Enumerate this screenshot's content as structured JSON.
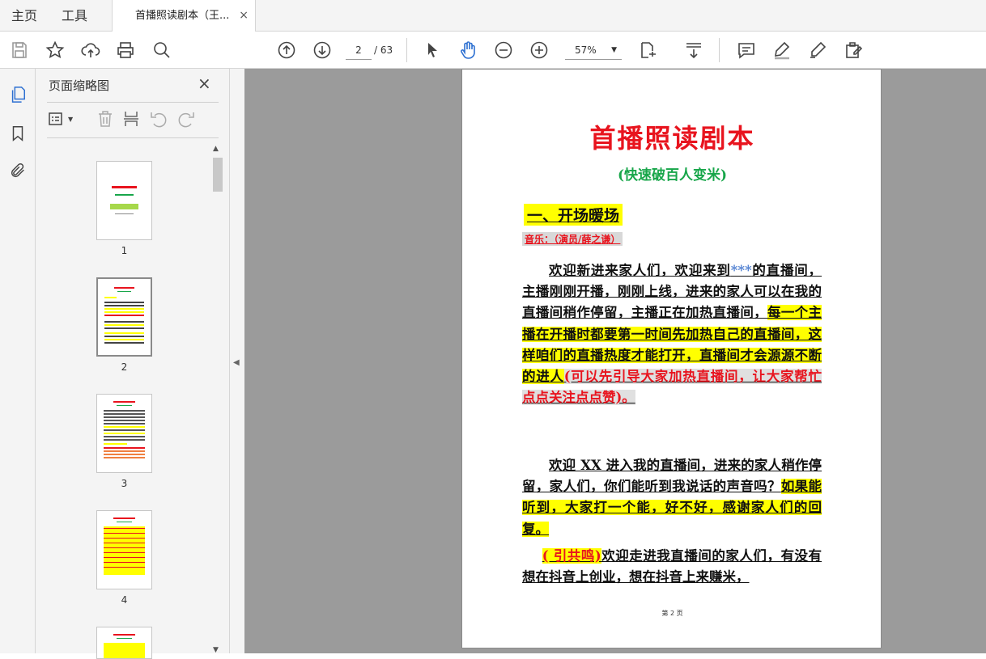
{
  "tabs": {
    "home": "主页",
    "tools": "工具",
    "doc": "首播照读剧本（王...",
    "doc_close": "×"
  },
  "toolbar": {
    "page_current": "2",
    "page_total": "/ 63",
    "zoom": "57%",
    "icons": [
      "save-icon",
      "star-icon",
      "cloud-upload-icon",
      "print-icon",
      "zoom-search-icon",
      "page-up-icon",
      "page-down-icon",
      "select-arrow-icon",
      "hand-icon",
      "zoom-out-icon",
      "zoom-in-icon",
      "fit-page-icon",
      "scroll-mode-icon",
      "comment-icon",
      "highlight-icon",
      "sign-icon",
      "fill-sign-icon"
    ]
  },
  "panel": {
    "title": "页面缩略图",
    "close": "×",
    "thumbnails": [
      "1",
      "2",
      "3",
      "4"
    ]
  },
  "document": {
    "title": "首播照读剧本",
    "subtitle": "(快速破百人变米)",
    "section": "一、开场暖场",
    "music": "音乐：（演员/薛之谦）",
    "p1_a": "欢迎新进来家人们，欢迎来到",
    "p1_stars": "***",
    "p1_b": "的直播间，主播刚刚开播，刚刚上线，进来的家人可以在我的直播间稍作停留，主播正在加热直播间，",
    "p1_c": "每一个主播在开播时都要第一时间先加热自己的直播间，这样咱们的直播热度才能打开，直播间才会源源不断的进人",
    "p1_d": "(可以先引导大家加热直播间，让大家帮忙点点关注点点赞)。",
    "p2_a": "欢迎 XX 进入我的直播间，进来的家人稍作停留，家人们，你们能听到我说话的声音吗？",
    "p2_b": "如果能听到，大家打一个能，好不好，感谢家人们的回复。",
    "p3_a": "( 引共鸣)",
    "p3_b": "欢迎走进我直播间的家人们，有没有想在抖音上创业，想在抖音上来赚米，",
    "footer": "第 2 页"
  }
}
